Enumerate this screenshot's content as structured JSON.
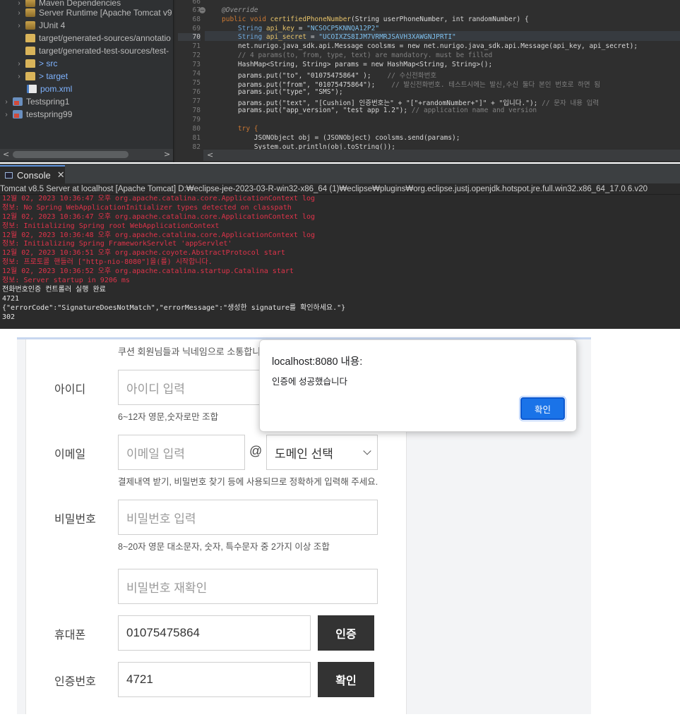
{
  "explorer": {
    "items": [
      {
        "label": "Maven Dependencies",
        "icon": "library-icon"
      },
      {
        "label": "Server Runtime [Apache Tomcat v9",
        "icon": "library-icon"
      },
      {
        "label": "JUnit 4",
        "icon": "library-icon"
      },
      {
        "label": "target/generated-sources/annotatio",
        "icon": "source-folder-icon"
      },
      {
        "label": "target/generated-test-sources/test-",
        "icon": "source-folder-icon"
      },
      {
        "label": "> src",
        "icon": "folder-icon"
      },
      {
        "label": "> target",
        "icon": "folder-icon"
      },
      {
        "label": "pom.xml",
        "icon": "xml-file-icon"
      },
      {
        "label": "Testspring1",
        "icon": "project-icon"
      },
      {
        "label": "testspring99",
        "icon": "project-icon"
      }
    ],
    "scroll_left": "<",
    "scroll_right": ">"
  },
  "editor": {
    "line_numbers": [
      "66",
      "67",
      "68",
      "69",
      "70",
      "71",
      "72",
      "73",
      "74",
      "75",
      "76",
      "77",
      "78",
      "79",
      "80",
      "81",
      "82"
    ],
    "current_line": "70",
    "fold_marker": "−",
    "scroll_left": "<",
    "lines": {
      "l67": "@Override",
      "l68a": "public void ",
      "l68b": "certifiedPhoneNumber",
      "l68c": "(String userPhoneNumber, int randomNumber) {",
      "l69a": "    String ",
      "l69b": "api_key",
      "l69c": " = ",
      "l69d": "\"NCSOCP5KNNQA12P2\"",
      "l70a": "    String ",
      "l70b": "api_secret",
      "l70c": " = ",
      "l70d": "\"UCOIXZS8IJM7VRMRJSAVH3XAWGNJPRTI\"",
      "l71": "    net.nurigo.java_sdk.api.Message coolsms = new net.nurigo.java_sdk.api.Message(api_key, api_secret);",
      "l72": "    // 4 params(to, from, type, text) are mandatory. must be filled",
      "l73": "    HashMap<String, String> params = new HashMap<String, String>();",
      "l74a": "    params.put(\"to\", \"01075475864\" );",
      "l74b": "    // 수신전화번호",
      "l75a": "    params.put(\"from\", \"01075475864\");",
      "l75b": "    // 발신전화번호. 테스트시에는 발신,수신 둘다 본인 번호로 하면 됨",
      "l76": "    params.put(\"type\", \"SMS\");",
      "l77a": "    params.put(\"text\", \"[Cushion] 인증번호는\" + \"[\"+randomNumber+\"]\" + \"입니다.\");",
      "l77b": " // 문자 내용 입력",
      "l78a": "    params.put(\"app_version\", \"test app 1.2\");",
      "l78b": " // application name and version",
      "l80": "    try {",
      "l81": "        JSONObject obj = (JSONObject) coolsms.send(params);",
      "l82": "        System.out.println(obj.toString());"
    }
  },
  "console": {
    "tab_label": "Console",
    "tab_close": "✕",
    "description": "Tomcat v8.5 Server at localhost [Apache Tomcat] D:₩eclipse-jee-2023-03-R-win32-x86_64 (1)₩eclipse₩plugins₩org.eclipse.justj.openjdk.hotspot.jre.full.win32.x86_64_17.0.6.v20",
    "lines": [
      {
        "text": "12월 02, 2023 10:36:47 오후 org.apache.catalina.core.ApplicationContext log",
        "kind": "err"
      },
      {
        "text": "정보: No Spring WebApplicationInitializer types detected on classpath",
        "kind": "err"
      },
      {
        "text": "12월 02, 2023 10:36:47 오후 org.apache.catalina.core.ApplicationContext log",
        "kind": "err"
      },
      {
        "text": "정보: Initializing Spring root WebApplicationContext",
        "kind": "err"
      },
      {
        "text": "12월 02, 2023 10:36:48 오후 org.apache.catalina.core.ApplicationContext log",
        "kind": "err"
      },
      {
        "text": "정보: Initializing Spring FrameworkServlet 'appServlet'",
        "kind": "err"
      },
      {
        "text": "12월 02, 2023 10:36:51 오후 org.apache.coyote.AbstractProtocol start",
        "kind": "err"
      },
      {
        "text": "정보: 프로토콜 핸들러 [\"http-nio-8080\"]을(를) 시작합니다.",
        "kind": "err"
      },
      {
        "text": "12월 02, 2023 10:36:52 오후 org.apache.catalina.startup.Catalina start",
        "kind": "err"
      },
      {
        "text": "정보: Server startup in 9206 ms",
        "kind": "err"
      },
      {
        "text": "전화번호인증 컨트롤러 실행 완료",
        "kind": "out"
      },
      {
        "text": "4721",
        "kind": "out"
      },
      {
        "text": "{\"errorCode\":\"SignatureDoesNotMatch\",\"errorMessage\":\"생성한 signature를 확인하세요.\"}",
        "kind": "out"
      },
      {
        "text": "302",
        "kind": "out"
      }
    ]
  },
  "signup_form": {
    "intro_text": "쿠션 회원님들과 닉네임으로 소통합니다",
    "id_label": "아이디",
    "id_placeholder": "아이디 입력",
    "id_hint": "6~12자 영문,숫자로만 조합",
    "email_label": "이메일",
    "email_placeholder": "이메일 입력",
    "email_at": "@",
    "domain_select_value": "도메인 선택",
    "email_hint": "결제내역 받기, 비밀번호 찾기 등에 사용되므로 정확하게 입력해 주세요.",
    "password_label": "비밀번호",
    "password_placeholder": "비밀번호 입력",
    "password_hint": "8~20자 영문 대소문자, 숫자, 특수문자 중 2가지 이상 조합",
    "password_confirm_placeholder": "비밀번호 재확인",
    "phone_label": "휴대폰",
    "phone_value": "01075475864",
    "phone_verify_button": "인증",
    "code_label": "인증번호",
    "code_value": "4721",
    "code_confirm_button": "확인"
  },
  "alert": {
    "title": "localhost:8080 내용:",
    "message": "인증에 성공했습니다",
    "ok_label": "확인"
  }
}
